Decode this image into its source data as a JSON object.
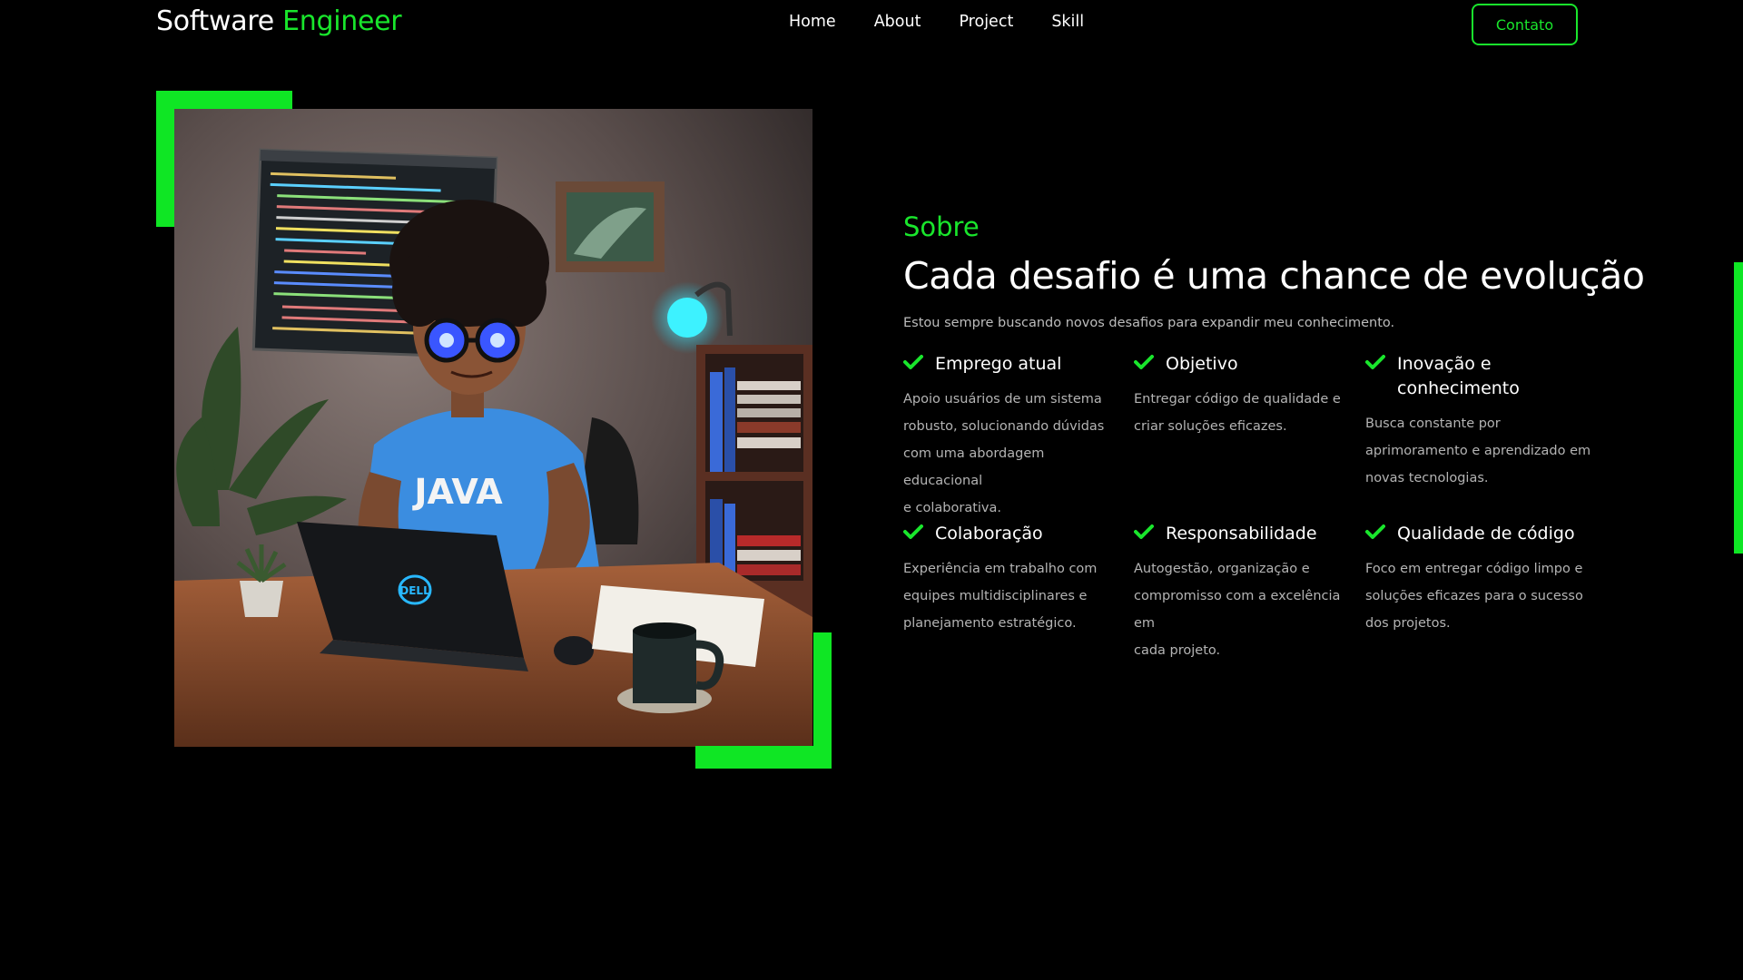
{
  "brand": {
    "name_part": "Software",
    "name_accent": "Engineer"
  },
  "nav": {
    "items": [
      {
        "label": "Home"
      },
      {
        "label": "About"
      },
      {
        "label": "Project"
      },
      {
        "label": "Skill"
      }
    ],
    "contact_label": "Contato"
  },
  "hero_image": {
    "shirt_text": "JAVA",
    "laptop_logo": "DELL"
  },
  "about": {
    "kicker": "Sobre",
    "title": "Cada desafio é uma chance de evolução",
    "intro": "Estou sempre buscando novos desafios para expandir meu conhecimento.",
    "features": [
      {
        "icon": "check-icon",
        "title": "Emprego atual",
        "text": [
          "Apoio usuários de um sistema",
          "robusto, solucionando dúvidas",
          "com uma abordagem educacional",
          "e colaborativa."
        ]
      },
      {
        "icon": "check-icon",
        "title": "Objetivo",
        "text": [
          "Entregar código de qualidade e",
          "criar soluções eficazes."
        ]
      },
      {
        "icon": "check-icon",
        "title": "Inovação e conhecimento",
        "text": [
          "Busca constante por",
          "aprimoramento e aprendizado em",
          "novas tecnologias."
        ]
      },
      {
        "icon": "check-icon",
        "title": "Colaboração",
        "text": [
          "Experiência em trabalho com",
          "equipes multidisciplinares e",
          "planejamento estratégico."
        ]
      },
      {
        "icon": "check-icon",
        "title": "Responsabilidade",
        "text": [
          "Autogestão, organização e",
          "compromisso com a excelência em",
          "cada projeto."
        ]
      },
      {
        "icon": "check-icon",
        "title": "Qualidade de código",
        "text": [
          "Foco em entregar código limpo e",
          "soluções eficazes para o sucesso",
          "dos projetos."
        ]
      }
    ]
  },
  "colors": {
    "accent": "#19e62c",
    "background": "#000000",
    "text": "#ffffff",
    "muted_text": "#b4b4b4"
  }
}
